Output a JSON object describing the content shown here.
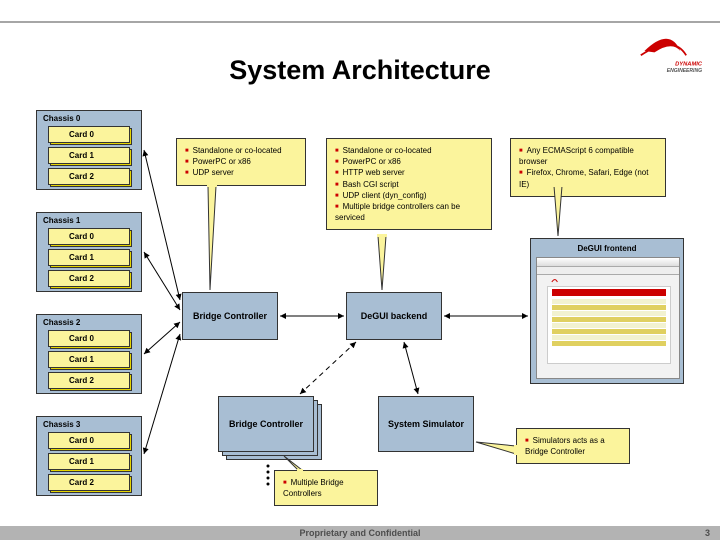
{
  "title": "System Architecture",
  "logo_text1": "DYNAMIC",
  "logo_text2": "ENGINEERING",
  "footer": {
    "text": "Proprietary and Confidential",
    "page": "3"
  },
  "chassis": [
    {
      "title": "Chassis 0",
      "cards": [
        "Card 0",
        "Card 1",
        "Card 2"
      ]
    },
    {
      "title": "Chassis 1",
      "cards": [
        "Card 0",
        "Card 1",
        "Card 2"
      ]
    },
    {
      "title": "Chassis 2",
      "cards": [
        "Card 0",
        "Card 1",
        "Card 2"
      ]
    },
    {
      "title": "Chassis 3",
      "cards": [
        "Card 0",
        "Card 1",
        "Card 2"
      ]
    }
  ],
  "boxes": {
    "bridge": "Bridge Controller",
    "backend": "DeGUI backend",
    "bridge_stack": "Bridge Controller",
    "simulator": "System Simulator",
    "frontend": "DeGUI frontend"
  },
  "notes": {
    "bridge": [
      "Standalone or co-located",
      "PowerPC or x86",
      "UDP server"
    ],
    "backend": [
      "Standalone or co-located",
      "PowerPC or x86",
      "HTTP web server",
      "Bash CGI script",
      "UDP client (dyn_config)",
      "Multiple bridge controllers can be serviced"
    ],
    "frontend": [
      "Any ECMAScript 6 compatible browser",
      "Firefox, Chrome, Safari, Edge (not IE)"
    ],
    "multi": [
      "Multiple Bridge Controllers"
    ],
    "sim": [
      "Simulators acts as a Bridge Controller"
    ]
  }
}
